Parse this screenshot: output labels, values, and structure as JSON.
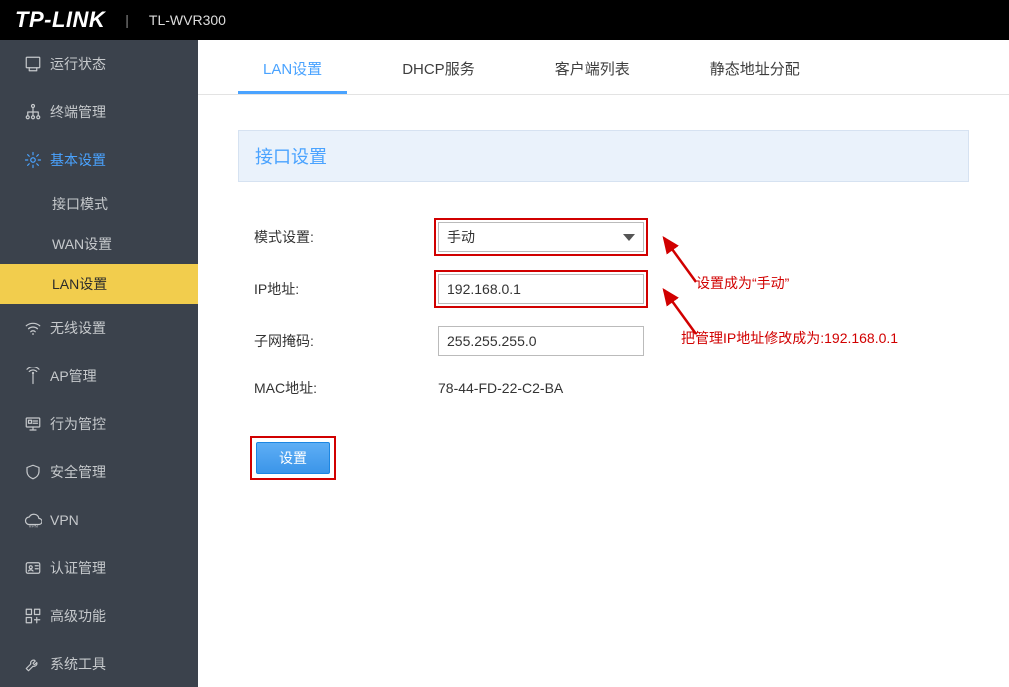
{
  "header": {
    "brand": "TP-LINK",
    "sep": "|",
    "model": "TL-WVR300"
  },
  "sidebar": [
    {
      "key": "status",
      "label": "运行状态",
      "icon": "dashboard"
    },
    {
      "key": "terminal",
      "label": "终端管理",
      "icon": "network"
    },
    {
      "key": "basic",
      "label": "基本设置",
      "icon": "gear",
      "active": true,
      "children": [
        {
          "key": "portmode",
          "label": "接口模式"
        },
        {
          "key": "wan",
          "label": "WAN设置"
        },
        {
          "key": "lan",
          "label": "LAN设置",
          "selected": true
        }
      ]
    },
    {
      "key": "wireless",
      "label": "无线设置",
      "icon": "wifi"
    },
    {
      "key": "ap",
      "label": "AP管理",
      "icon": "antenna"
    },
    {
      "key": "behavior",
      "label": "行为管控",
      "icon": "monitor"
    },
    {
      "key": "security",
      "label": "安全管理",
      "icon": "shield"
    },
    {
      "key": "vpn",
      "label": "VPN",
      "icon": "cloud"
    },
    {
      "key": "auth",
      "label": "认证管理",
      "icon": "id"
    },
    {
      "key": "advance",
      "label": "高级功能",
      "icon": "grid"
    },
    {
      "key": "system",
      "label": "系统工具",
      "icon": "wrench"
    }
  ],
  "tabs": [
    {
      "label": "LAN设置",
      "active": true
    },
    {
      "label": "DHCP服务"
    },
    {
      "label": "客户端列表"
    },
    {
      "label": "静态地址分配"
    }
  ],
  "panel_title": "接口设置",
  "form": {
    "mode_label": "模式设置:",
    "mode_value": "手动",
    "ip_label": "IP地址:",
    "ip_value": "192.168.0.1",
    "mask_label": "子网掩码:",
    "mask_value": "255.255.255.0",
    "mac_label": "MAC地址:",
    "mac_value": "78-44-FD-22-C2-BA",
    "submit": "设置"
  },
  "annotations": {
    "a1": "设置成为“手动”",
    "a2": "把管理IP地址修改成为:192.168.0.1"
  }
}
